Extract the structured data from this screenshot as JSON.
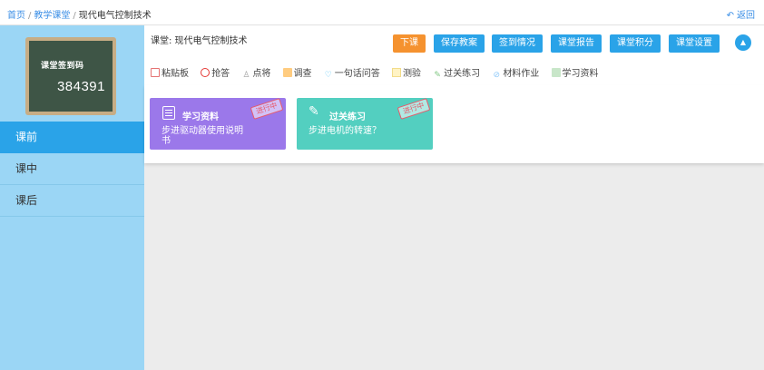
{
  "breadcrumb": {
    "home": "首页",
    "sep": "/",
    "classroom": "教学课堂",
    "current": "现代电气控制技术"
  },
  "back_label": "返回",
  "sidebar": {
    "board_title": "课堂签到码",
    "board_code": "384391",
    "items": [
      {
        "label": "课前",
        "active": true
      },
      {
        "label": "课中",
        "active": false
      },
      {
        "label": "课后",
        "active": false
      }
    ]
  },
  "header": {
    "course": "课堂: 现代电气控制技术",
    "buttons": [
      "下课",
      "保存教案",
      "签到情况",
      "课堂报告",
      "课堂积分",
      "课堂设置"
    ]
  },
  "tools": [
    {
      "label": "粘贴板",
      "icon": "clipboard-icon",
      "color": "#e57373"
    },
    {
      "label": "抢答",
      "icon": "buzzer-icon",
      "color": "#e53935"
    },
    {
      "label": "点将",
      "icon": "user-icon",
      "color": "#9e9e9e"
    },
    {
      "label": "调查",
      "icon": "survey-icon",
      "color": "#ffb74d"
    },
    {
      "label": "一句话问答",
      "icon": "bulb-icon",
      "color": "#4fc3f7"
    },
    {
      "label": "测验",
      "icon": "quiz-icon",
      "color": "#ffe082"
    },
    {
      "label": "过关练习",
      "icon": "pencil-icon",
      "color": "#81c784"
    },
    {
      "label": "材料作业",
      "icon": "attachment-icon",
      "color": "#90caf9"
    },
    {
      "label": "学习资料",
      "icon": "document-icon",
      "color": "#a5d6a7"
    }
  ],
  "cards": [
    {
      "title": "学习资料",
      "desc": "步进驱动器使用说明书",
      "status": "进行中",
      "color": "#9b78ea",
      "icon": "document-icon"
    },
    {
      "title": "过关练习",
      "desc": "步进电机的转速？",
      "status": "进行中",
      "color": "#53cfc0",
      "icon": "pencil-icon"
    }
  ]
}
